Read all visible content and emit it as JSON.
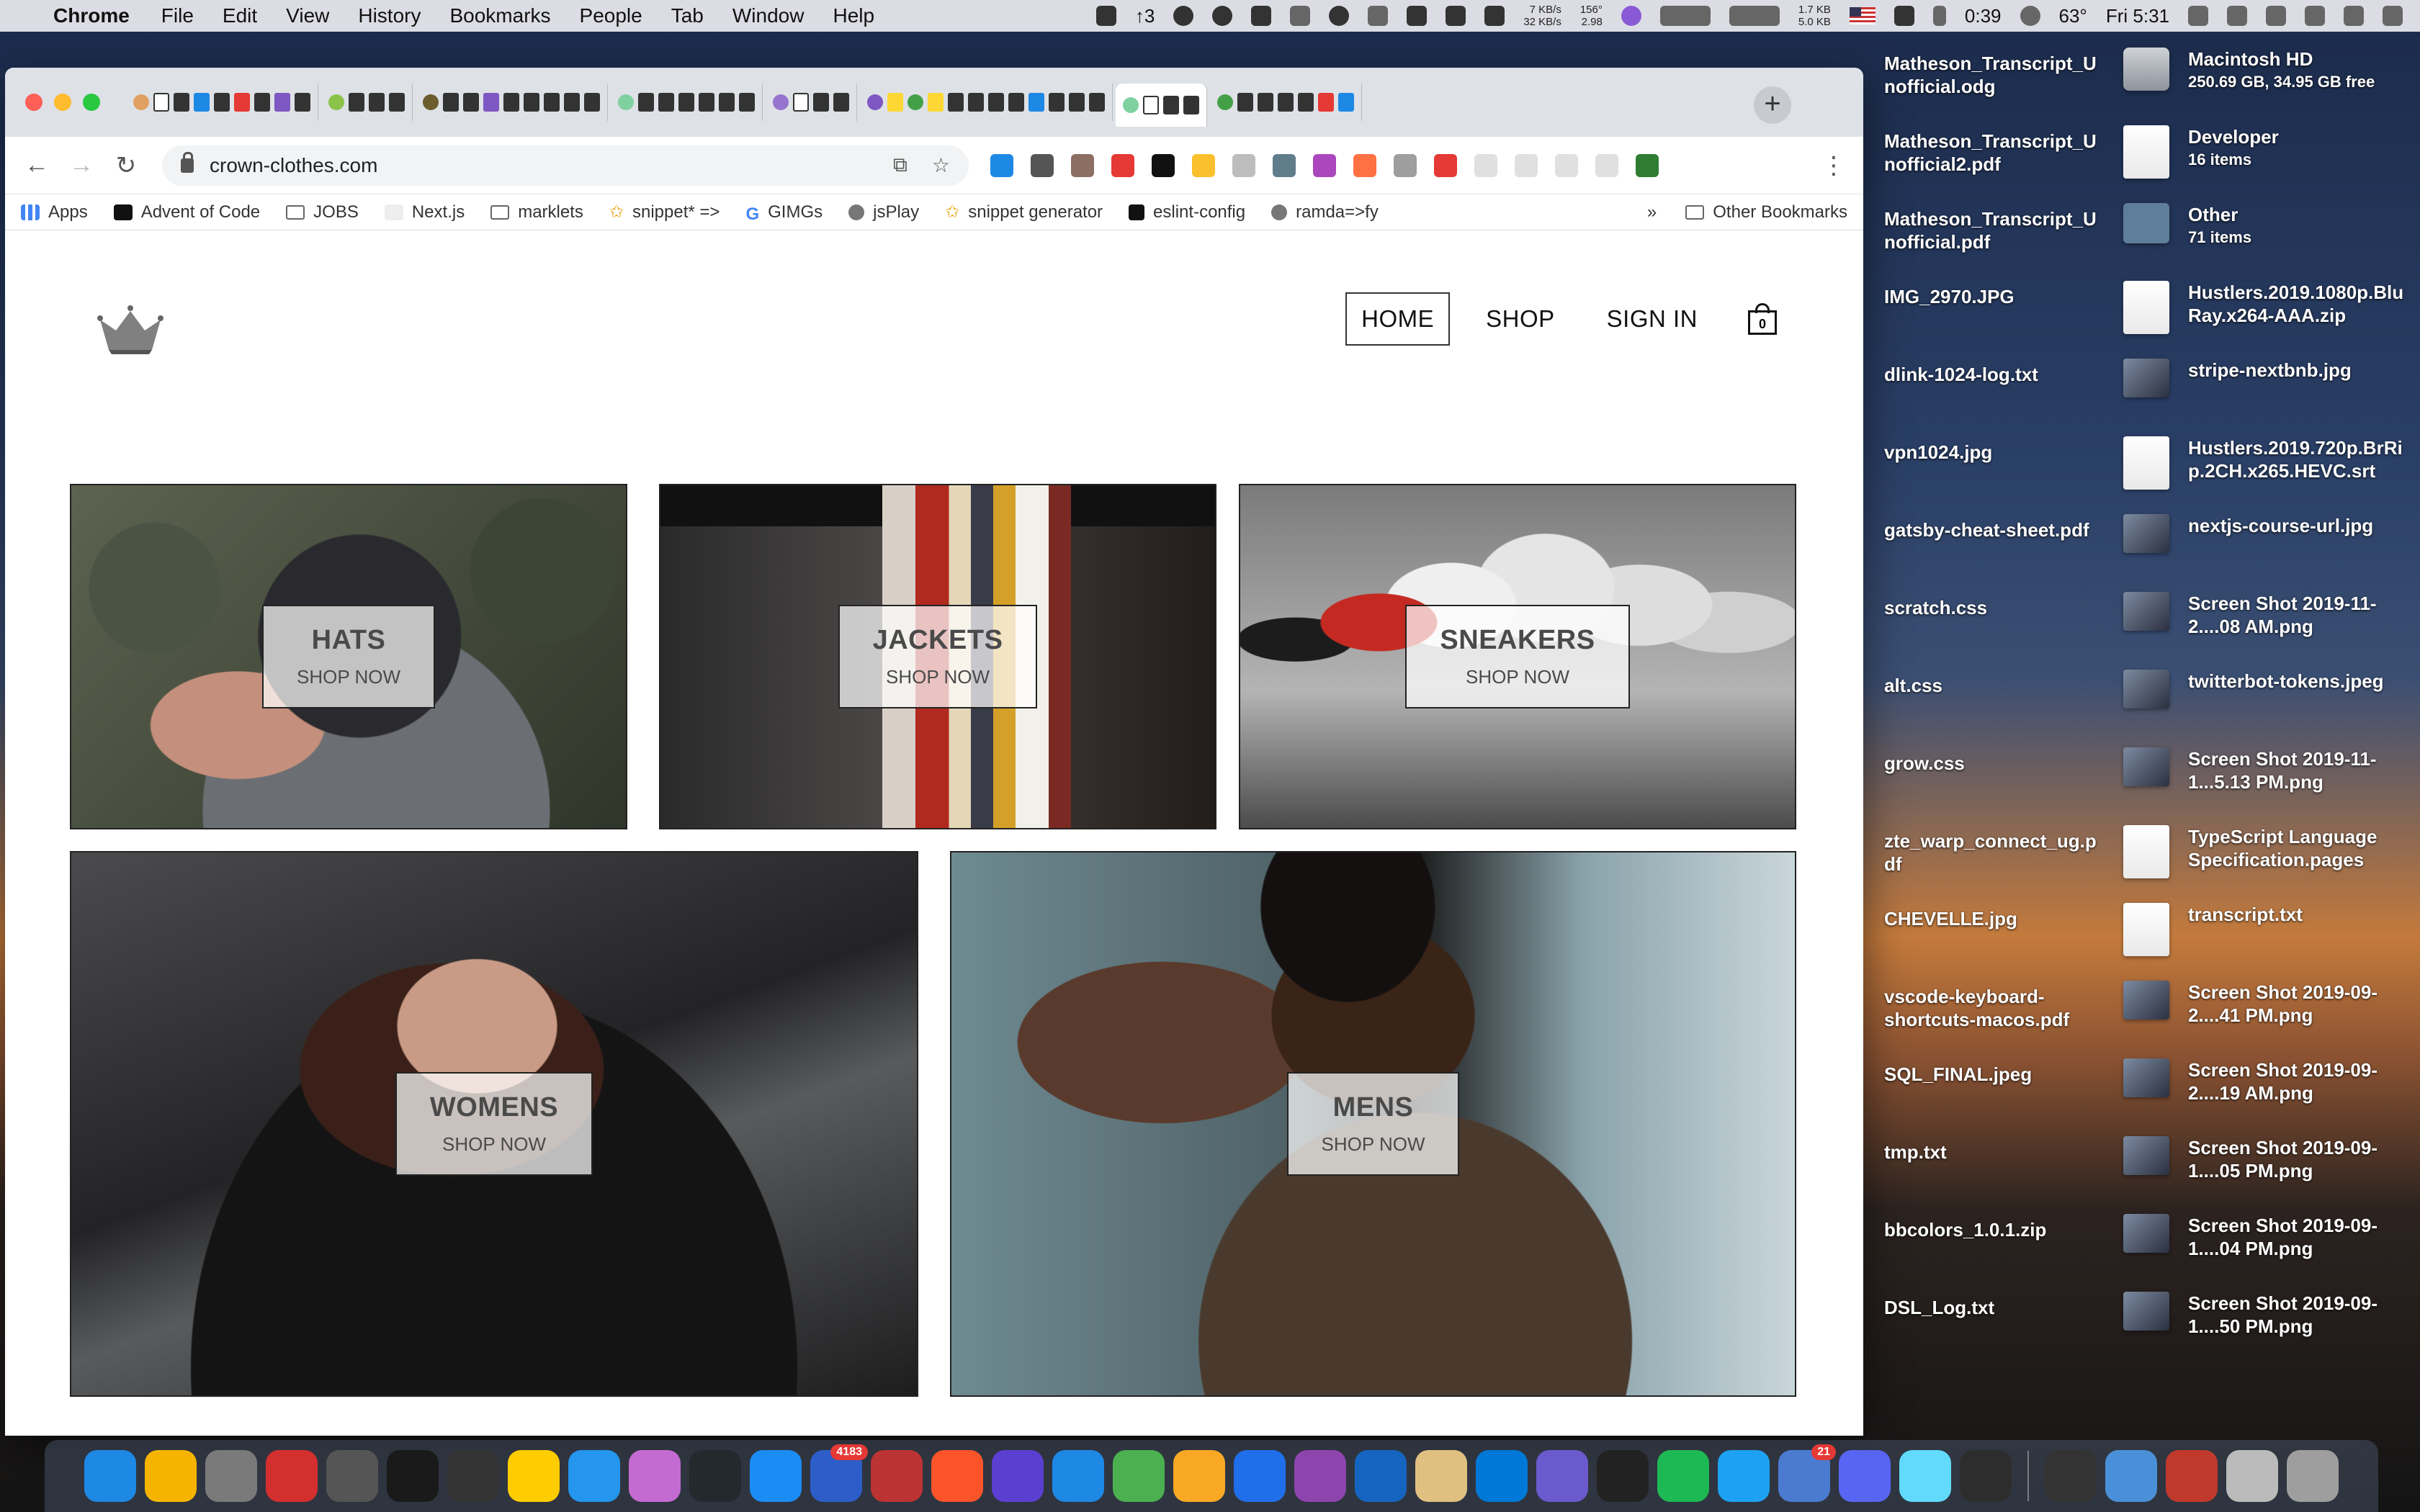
{
  "menubar": {
    "app_name": "Chrome",
    "menus": [
      "File",
      "Edit",
      "View",
      "History",
      "Bookmarks",
      "People",
      "Tab",
      "Window",
      "Help"
    ],
    "status_count": "↑3",
    "net_up": "7 KB/s",
    "net_down": "32 KB/s",
    "temp_top": "156°",
    "temp_bottom": "2.98",
    "net2_up": "1.7 KB",
    "net2_down": "5.0 KB",
    "battery_time": "0:39",
    "weather": "63°",
    "clock": "Fri 5:31"
  },
  "browser": {
    "url": "crown-clothes.com",
    "new_tab_label": "+",
    "bookmarks": [
      {
        "label": "Apps",
        "icon": "apps-grid-icon"
      },
      {
        "label": "Advent of Code",
        "icon": "star-icon"
      },
      {
        "label": "JOBS",
        "icon": "folder-icon"
      },
      {
        "label": "Next.js",
        "icon": "nextjs-icon"
      },
      {
        "label": "marklets",
        "icon": "folder-icon"
      },
      {
        "label": "snippet* =>",
        "icon": "star-icon"
      },
      {
        "label": "GIMGs",
        "icon": "google-icon"
      },
      {
        "label": "jsPlay",
        "icon": "globe-icon"
      },
      {
        "label": "snippet generator",
        "icon": "star-icon"
      },
      {
        "label": "eslint-config",
        "icon": "medium-icon"
      },
      {
        "label": "ramda=>fy",
        "icon": "globe-icon"
      }
    ],
    "overflow": "»",
    "other_bookmarks": "Other Bookmarks"
  },
  "site": {
    "nav": {
      "home": "HOME",
      "shop": "SHOP",
      "sign_in": "SIGN IN",
      "cart_count": "0"
    },
    "directory": [
      {
        "title": "HATS",
        "subtitle": "SHOP NOW"
      },
      {
        "title": "JACKETS",
        "subtitle": "SHOP NOW"
      },
      {
        "title": "SNEAKERS",
        "subtitle": "SHOP NOW"
      },
      {
        "title": "WOMENS",
        "subtitle": "SHOP NOW"
      },
      {
        "title": "MENS",
        "subtitle": "SHOP NOW"
      }
    ]
  },
  "desktop": {
    "col1": [
      "Matheson_Transcript_Unofficial.odg",
      "Matheson_Transcript_Unofficial2.pdf",
      "Matheson_Transcript_Unofficial.pdf",
      "IMG_2970.JPG",
      "dlink-1024-log.txt",
      "vpn1024.jpg",
      "gatsby-cheat-sheet.pdf",
      "scratch.css",
      "alt.css",
      "grow.css",
      "zte_warp_connect_ug.pdf",
      "CHEVELLE.jpg",
      "vscode-keyboard-shortcuts-macos.pdf",
      "SQL_FINAL.jpeg",
      "tmp.txt",
      "bbcolors_1.0.1.zip",
      "DSL_Log.txt"
    ],
    "col2": [
      {
        "name": "Macintosh HD",
        "info": "250.69 GB, 34.95 GB free"
      },
      {
        "name": "Developer",
        "info": "16 items"
      },
      {
        "name": "Other",
        "info": "71 items"
      },
      {
        "name": "Hustlers.2019.1080p.BluRay.x264-AAA.zip",
        "info": ""
      },
      {
        "name": "stripe-nextbnb.jpg",
        "info": ""
      },
      {
        "name": "Hustlers.2019.720p.BrRip.2CH.x265.HEVC.srt",
        "info": ""
      },
      {
        "name": "nextjs-course-url.jpg",
        "info": ""
      },
      {
        "name": "Screen Shot 2019-11-2....08 AM.png",
        "info": ""
      },
      {
        "name": "twitterbot-tokens.jpeg",
        "info": ""
      },
      {
        "name": "Screen Shot 2019-11-1...5.13 PM.png",
        "info": ""
      },
      {
        "name": "TypeScript Language Specification.pages",
        "info": ""
      },
      {
        "name": "transcript.txt",
        "info": ""
      },
      {
        "name": "Screen Shot 2019-09-2....41 PM.png",
        "info": ""
      },
      {
        "name": "Screen Shot 2019-09-2....19 AM.png",
        "info": ""
      },
      {
        "name": "Screen Shot 2019-09-1....05 PM.png",
        "info": ""
      },
      {
        "name": "Screen Shot 2019-09-1....04 PM.png",
        "info": ""
      },
      {
        "name": "Screen Shot 2019-09-1....50 PM.png",
        "info": ""
      }
    ]
  },
  "dock": {
    "badges": {
      "mail_count": "4183",
      "twitter_count": "21"
    },
    "colors": [
      "#1e88e5",
      "#f5b400",
      "#7a7a7a",
      "#d32f2f",
      "#555555",
      "#1a1a1a",
      "#333333",
      "#ffcc00",
      "#2496ed",
      "#c36bd1",
      "#24292e",
      "#1c8cf5",
      "#2c5dc9",
      "#b33",
      "#fb542b",
      "#5b3fd1",
      "#1e88e5",
      "#4caf50",
      "#f9a825",
      "#1f6feb",
      "#8e44ad",
      "#1565c0",
      "#e0c080",
      "#0078d7",
      "#6a5acd",
      "#222222",
      "#1db954",
      "#1da1f2",
      "#4a7bd1",
      "#5865f2",
      "#61dafb",
      "#2d2d2d",
      "#333333",
      "#4a90d9",
      "#c0392b",
      "#bbbbbb",
      "#9e9e9e"
    ]
  }
}
